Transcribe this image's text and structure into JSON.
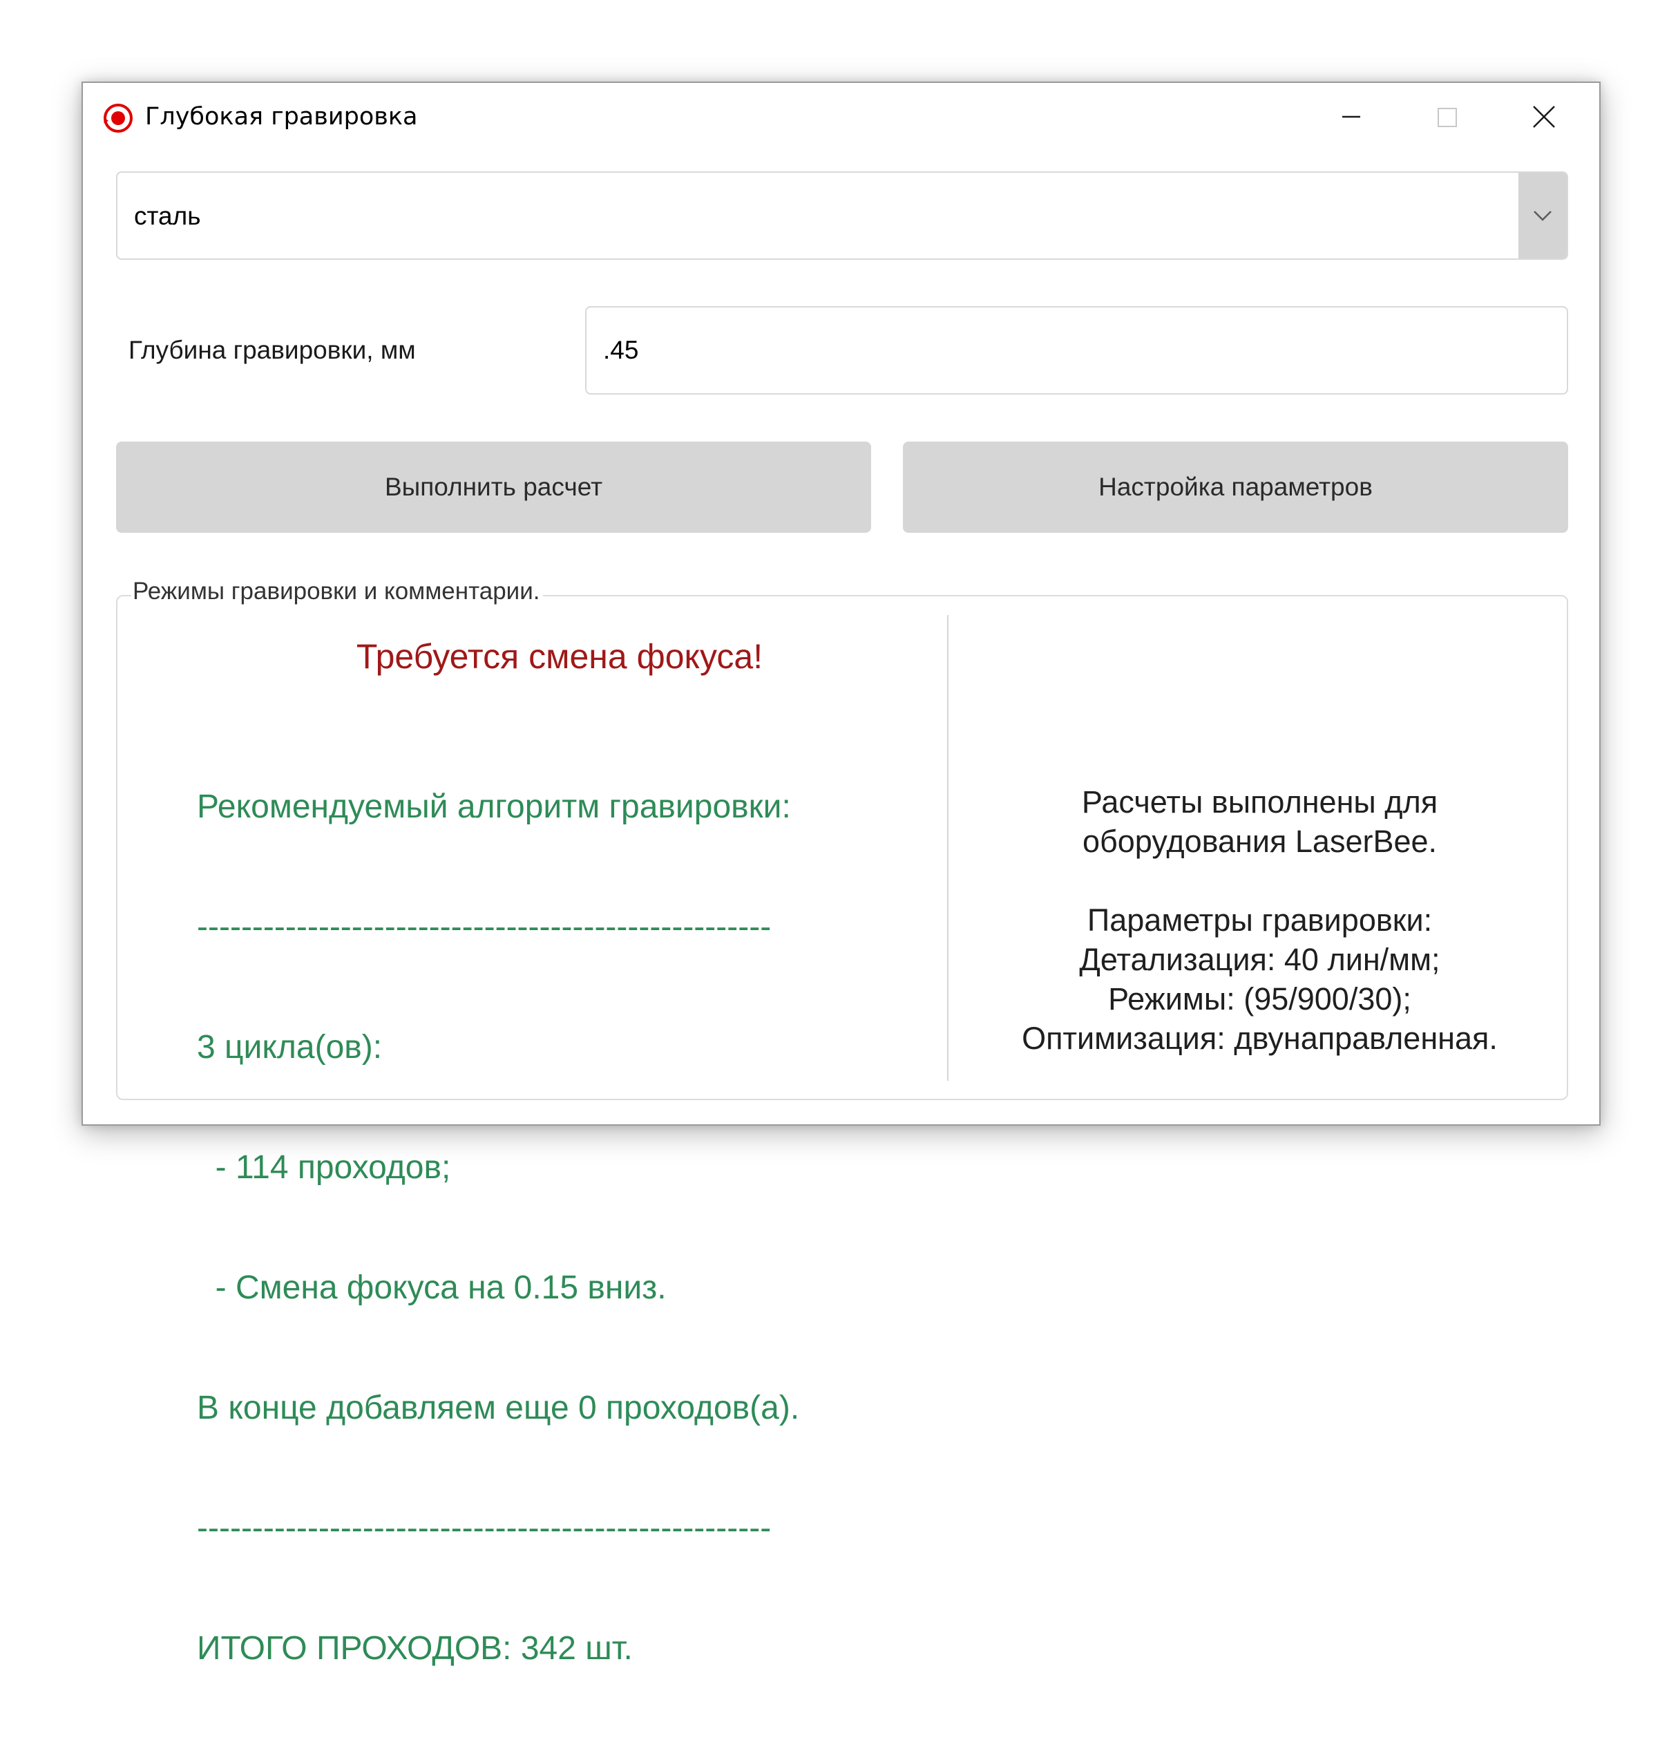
{
  "window": {
    "title": "Глубокая гравировка"
  },
  "material": {
    "selected": "сталь"
  },
  "depth": {
    "label": "Глубина гравировки, мм",
    "value": ".45"
  },
  "buttons": {
    "calculate": "Выполнить расчет",
    "settings": "Настройка параметров"
  },
  "results": {
    "group_title": "Режимы гравировки и комментарии.",
    "warning": "Требуется смена фокуса!",
    "algorithm_lines": [
      "Рекомендуемый алгоритм гравировки:",
      "----------------------------------------------------",
      "3 цикла(ов):",
      "  - 114 проходов;",
      "  - Смена фокуса на 0.15 вниз.",
      "В конце добавляем еще 0 проходов(а).",
      "----------------------------------------------------",
      "ИТОГО ПРОХОДОВ: 342 шт."
    ],
    "info_lines": [
      "Расчеты выполнены для",
      "оборудования LaserBee.",
      "",
      "Параметры гравировки:",
      "Детализация: 40 лин/мм;",
      "Режимы: (95/900/30);",
      "Оптимизация: двунаправленная."
    ]
  },
  "colors": {
    "warning": "#a01818",
    "algorithm": "#2e8b57",
    "button_bg": "#d6d6d6",
    "icon_red": "#e00000"
  },
  "icons": {
    "app": "record-icon",
    "dropdown": "chevron-down-icon",
    "minimize": "minimize-icon",
    "maximize": "maximize-icon",
    "close": "close-icon"
  }
}
